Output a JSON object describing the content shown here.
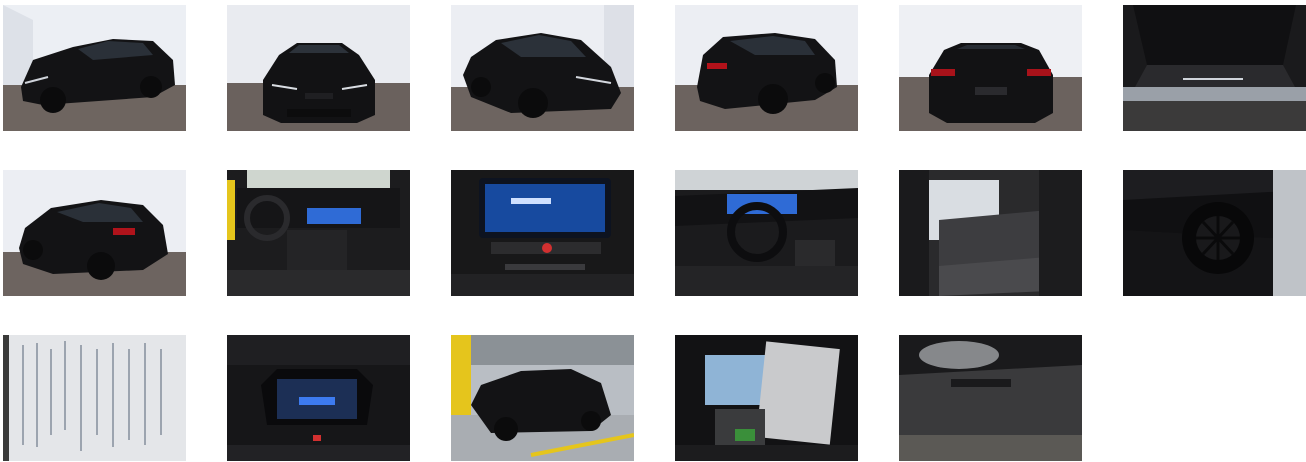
{
  "gallery": {
    "photos": [
      {
        "id": 1,
        "subject": "front-three-quarter-left"
      },
      {
        "id": 2,
        "subject": "front"
      },
      {
        "id": 3,
        "subject": "front-three-quarter-right"
      },
      {
        "id": 4,
        "subject": "rear-three-quarter-right"
      },
      {
        "id": 5,
        "subject": "rear"
      },
      {
        "id": 6,
        "subject": "trunk"
      },
      {
        "id": 7,
        "subject": "rear-three-quarter-left"
      },
      {
        "id": 8,
        "subject": "dashboard"
      },
      {
        "id": 9,
        "subject": "infotainment-screen"
      },
      {
        "id": 10,
        "subject": "driver-cockpit"
      },
      {
        "id": 11,
        "subject": "rear-seats"
      },
      {
        "id": 12,
        "subject": "wheel-detail"
      },
      {
        "id": 13,
        "subject": "handover-document"
      },
      {
        "id": 14,
        "subject": "instrument-cluster"
      },
      {
        "id": 15,
        "subject": "car-in-garage"
      },
      {
        "id": 16,
        "subject": "manuals-and-keys"
      },
      {
        "id": 17,
        "subject": "trunk-cover-label"
      }
    ]
  },
  "colors": {
    "studio_wall": "#eef0f5",
    "studio_floor": "#6d6460",
    "car_body": "#141416",
    "interior": "#1b1b1d",
    "screen_blue": "#2f6bd6",
    "garage_yellow": "#e5c51c"
  }
}
